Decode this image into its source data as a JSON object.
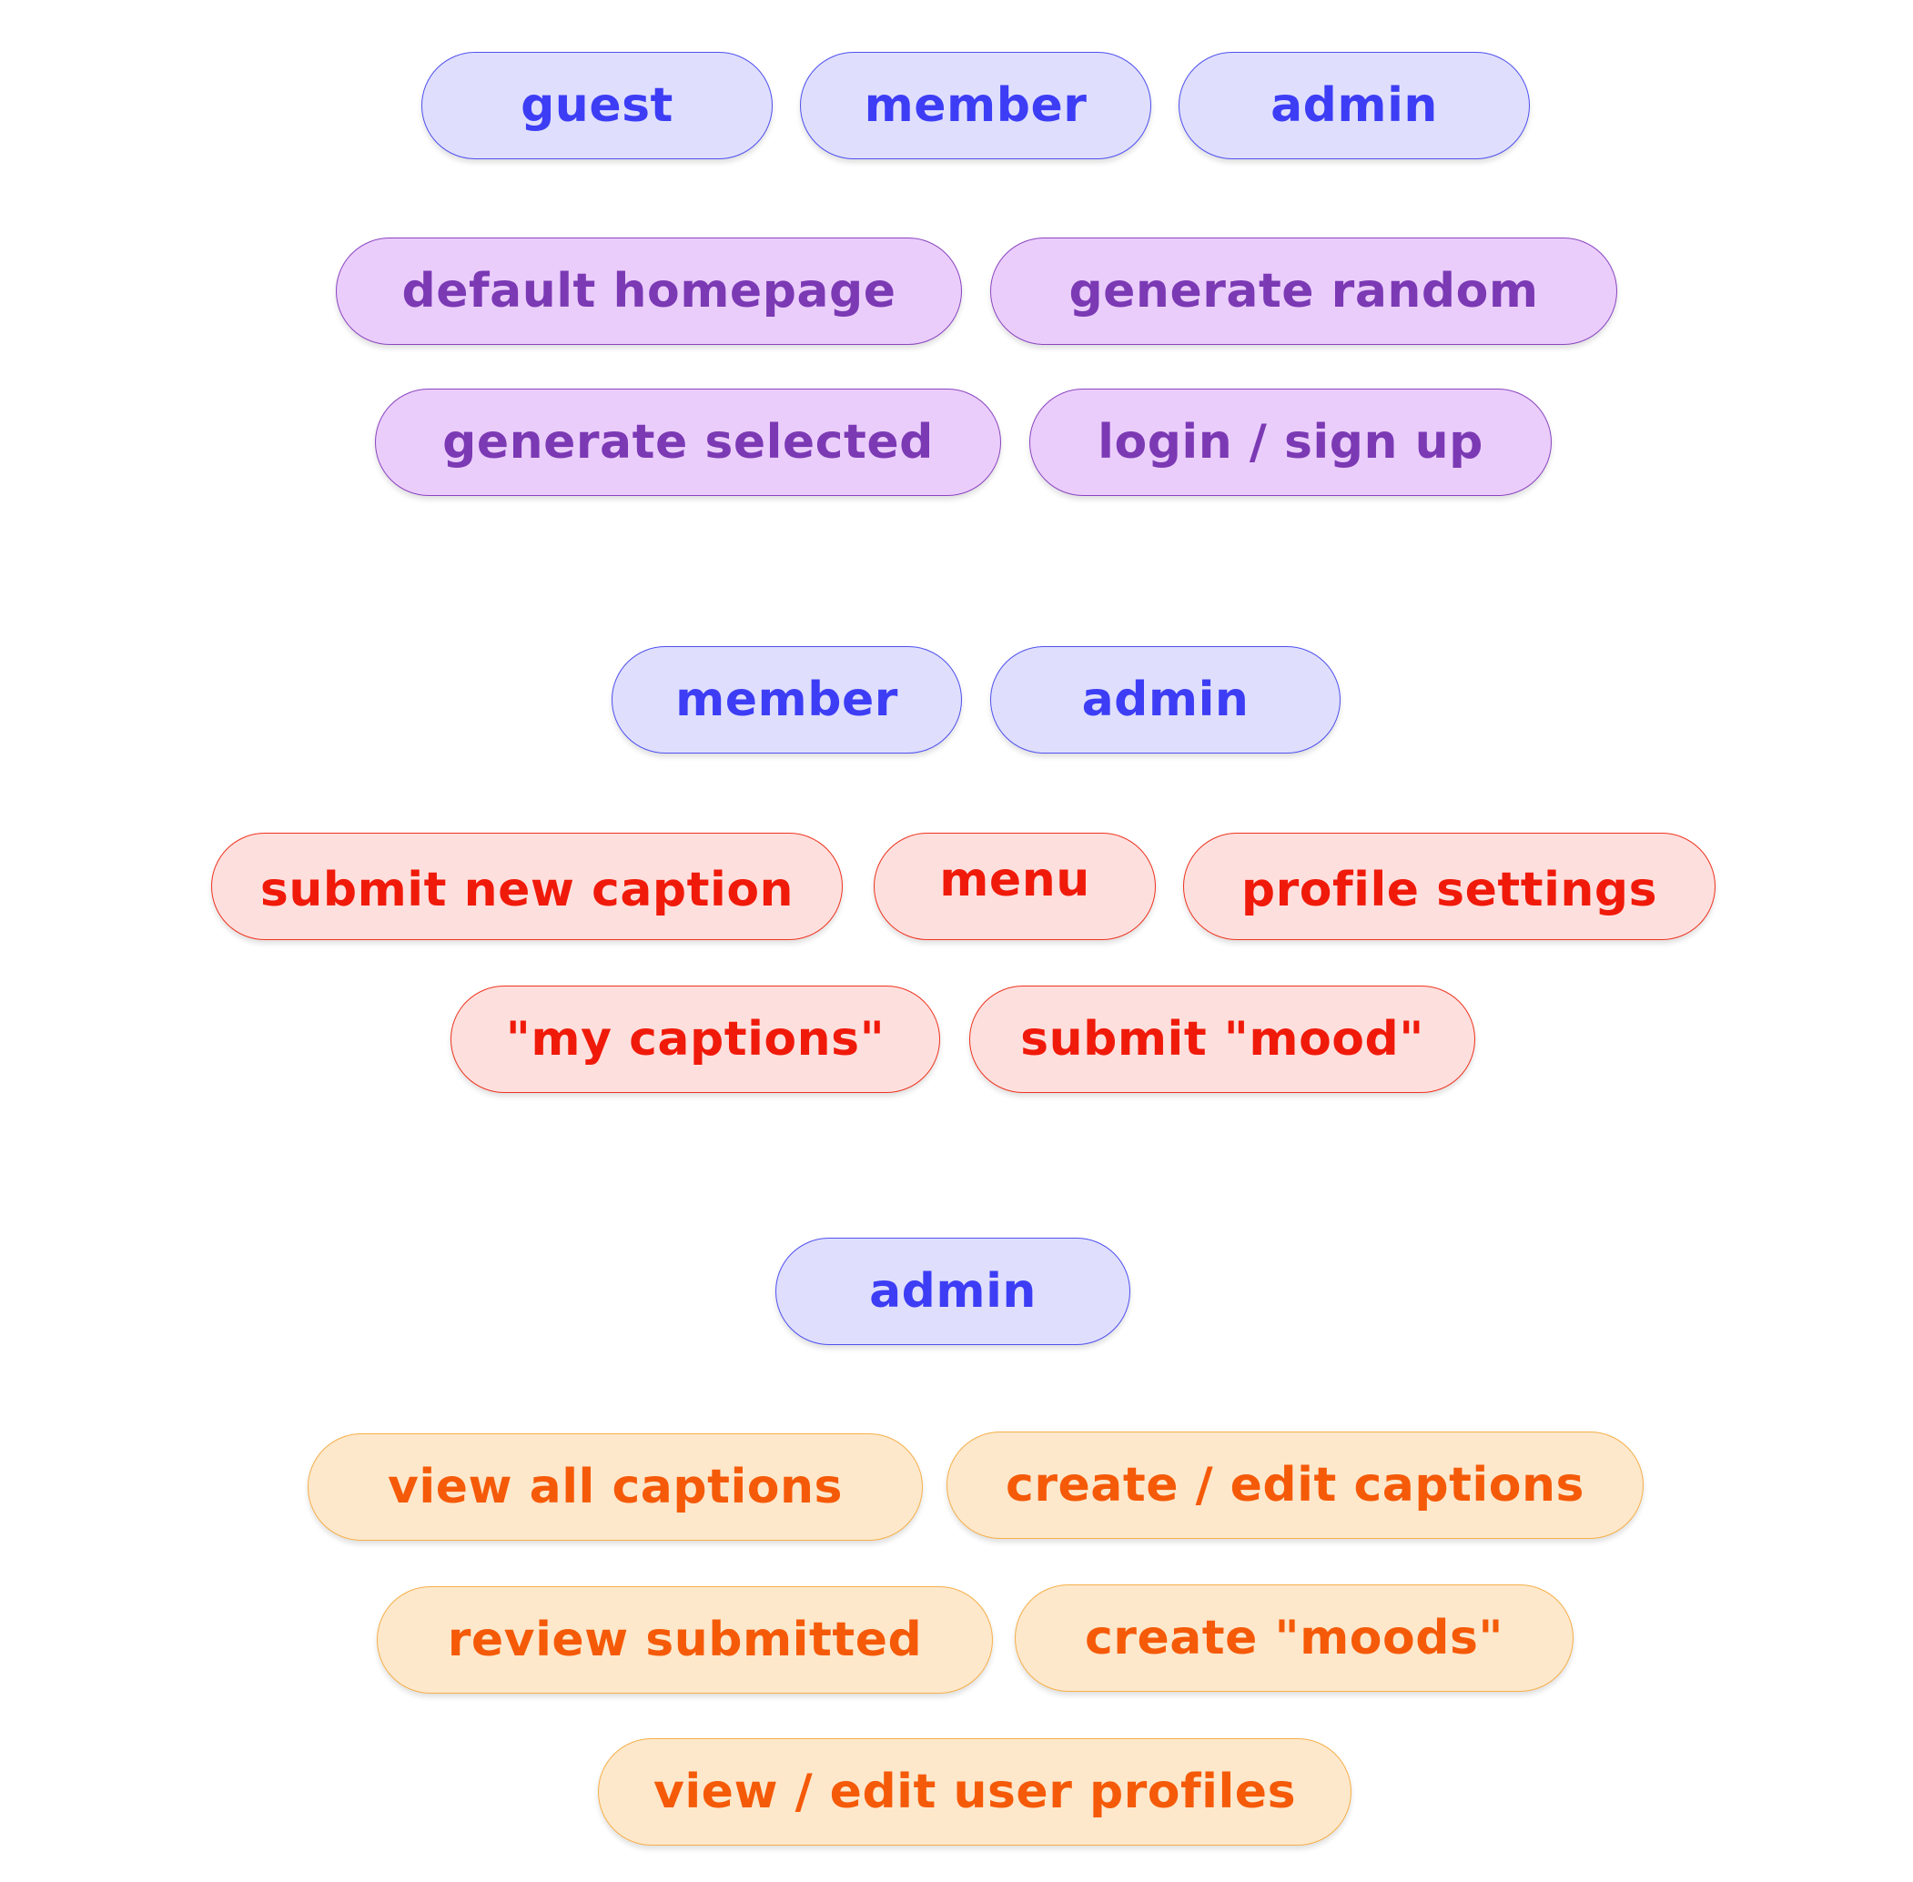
{
  "colors": {
    "role_fill": "#dfdffd",
    "role_text": "#3d3df5",
    "guest_fill": "#ebcdfc",
    "guest_text": "#7b39b4",
    "member_fill": "#fde0de",
    "member_text": "#f01a0a",
    "admin_fill": "#fde8cc",
    "admin_text": "#f55a08"
  },
  "section_guest": {
    "roles": [
      "guest",
      "member",
      "admin"
    ],
    "features": [
      "default homepage",
      "generate random",
      "generate selected",
      "login / sign up"
    ]
  },
  "section_member": {
    "roles": [
      "member",
      "admin"
    ],
    "features": [
      "submit new caption",
      "menu",
      "profile settings",
      "\"my captions\"",
      "submit \"mood\""
    ]
  },
  "section_admin": {
    "roles": [
      "admin"
    ],
    "features": [
      "view all captions",
      "create / edit captions",
      "review submitted",
      "create \"moods\"",
      "view / edit user profiles"
    ]
  }
}
